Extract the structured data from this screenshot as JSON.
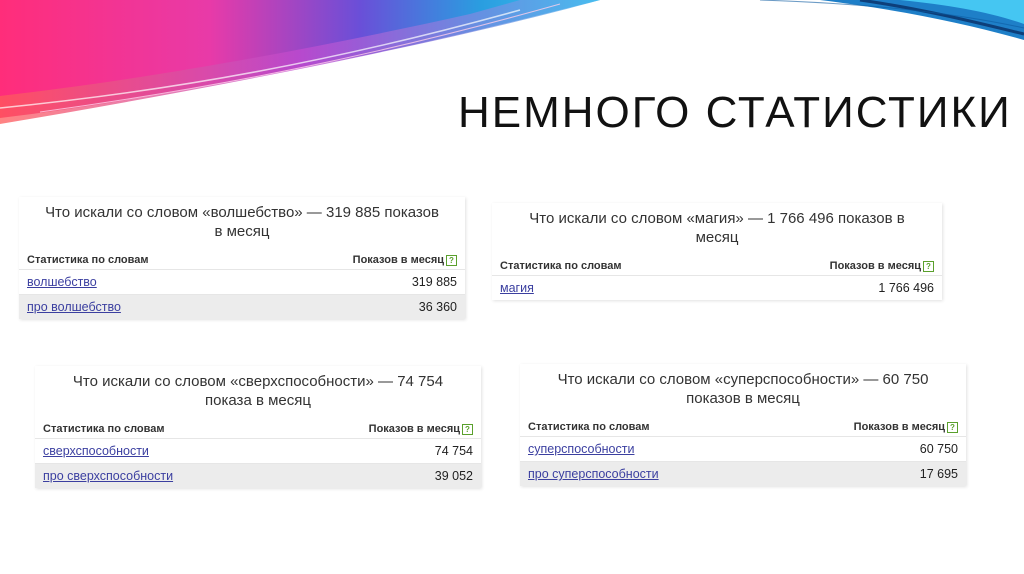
{
  "slide": {
    "title": "НЕМНОГО СТАТИСТИКИ"
  },
  "colors": {
    "link": "#3b3fa0",
    "help_badge": "#5aa02c"
  },
  "cards": [
    {
      "heading_line1": "Что искали со словом «волшебство» — 319 885 показов",
      "heading_line2": "в месяц",
      "col_words": "Статистика по словам",
      "col_shows": "Показов в месяц",
      "help": "?",
      "rows": [
        {
          "word": "волшебство",
          "count": "319 885"
        },
        {
          "word": "про волшебство",
          "count": "36 360"
        }
      ]
    },
    {
      "heading_line1": "Что искали со словом «магия» — 1 766 496 показов в",
      "heading_line2": "месяц",
      "col_words": "Статистика по словам",
      "col_shows": "Показов в месяц",
      "help": "?",
      "rows": [
        {
          "word": "магия",
          "count": "1 766 496"
        }
      ]
    },
    {
      "heading_line1": "Что искали со словом «сверхспособности» — 74 754",
      "heading_line2": "показа в месяц",
      "col_words": "Статистика по словам",
      "col_shows": "Показов в месяц",
      "help": "?",
      "rows": [
        {
          "word": "сверхспособности",
          "count": "74 754"
        },
        {
          "word": "про сверхспособности",
          "count": "39 052"
        }
      ]
    },
    {
      "heading_line1": "Что искали со словом «суперспособности» — 60 750",
      "heading_line2": "показов в месяц",
      "col_words": "Статистика по словам",
      "col_shows": "Показов в месяц",
      "help": "?",
      "rows": [
        {
          "word": "суперспособности",
          "count": "60 750"
        },
        {
          "word": "про суперспособности",
          "count": "17 695"
        }
      ]
    }
  ]
}
